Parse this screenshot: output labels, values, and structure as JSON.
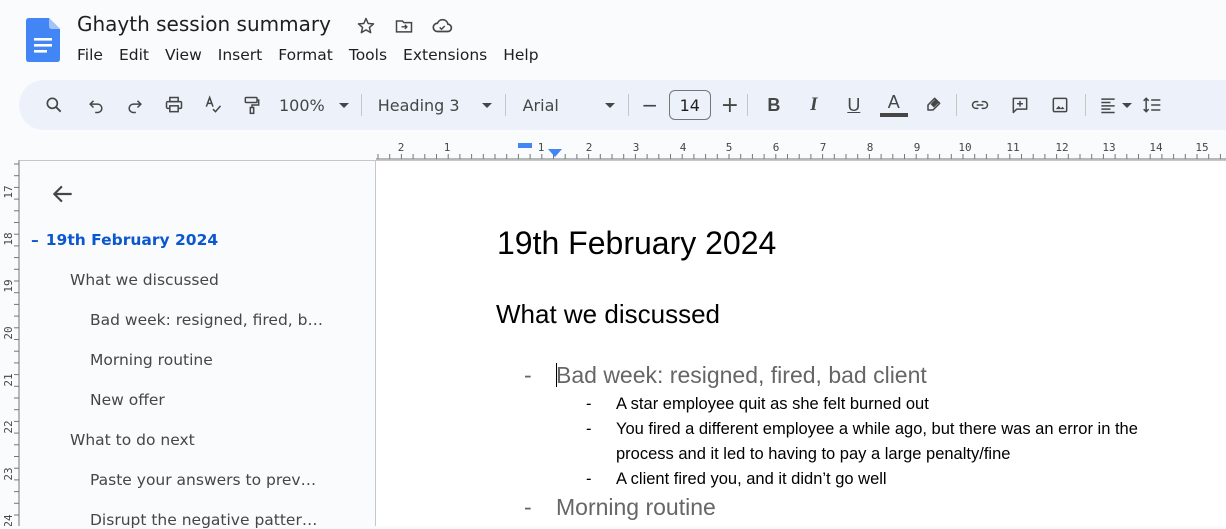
{
  "app": {
    "doc_title": "Ghayth session summary",
    "title_icons": [
      "star-icon",
      "move-to-folder-icon",
      "cloud-saved-icon"
    ],
    "menu": [
      "File",
      "Edit",
      "View",
      "Insert",
      "Format",
      "Tools",
      "Extensions",
      "Help"
    ]
  },
  "toolbar": {
    "zoom": "100%",
    "style": "Heading 3",
    "font": "Arial",
    "font_size": "14",
    "minus": "−",
    "plus": "+",
    "bold": "B",
    "italic": "I",
    "underline": "U",
    "text_color": "A",
    "text_color_value": "#444746"
  },
  "ruler": {
    "horizontal_ticks": [
      "2",
      "1",
      "1",
      "2",
      "3",
      "4",
      "5",
      "6",
      "7",
      "8",
      "9",
      "10",
      "11",
      "12",
      "13",
      "14",
      "15"
    ],
    "vertical_ticks": [
      "17",
      "18",
      "19",
      "20",
      "21",
      "22",
      "23",
      "24"
    ]
  },
  "outline": {
    "items": [
      {
        "label": "19th February 2024",
        "level": 1,
        "active": true,
        "prefix": "–"
      },
      {
        "label": "What we discussed",
        "level": 2
      },
      {
        "label": "Bad week: resigned, fired, b…",
        "level": 3
      },
      {
        "label": "Morning routine",
        "level": 3
      },
      {
        "label": "New offer",
        "level": 3
      },
      {
        "label": "What to do next",
        "level": 2
      },
      {
        "label": "Paste your answers to prev…",
        "level": 3
      },
      {
        "label": "Disrupt the negative patter…",
        "level": 3
      }
    ]
  },
  "document": {
    "title": "19th February 2024",
    "heading2": "What we discussed",
    "bullets": [
      {
        "text": "Bad week: resigned, fired, bad client",
        "children": [
          "A star employee quit as she felt burned out",
          "You fired a different employee a while ago, but there was an error in the",
          "process and it led to having to pay a large penalty/fine",
          "A client fired you, and it didn’t go well"
        ]
      },
      {
        "text": "Morning routine",
        "children": []
      }
    ],
    "bullet_symbol": "-"
  },
  "colors": {
    "accent": "#0b57d0",
    "toolbar_bg": "#edf2fa",
    "app_bg": "#f9fbfd",
    "doc_logo": "#4285f4"
  }
}
